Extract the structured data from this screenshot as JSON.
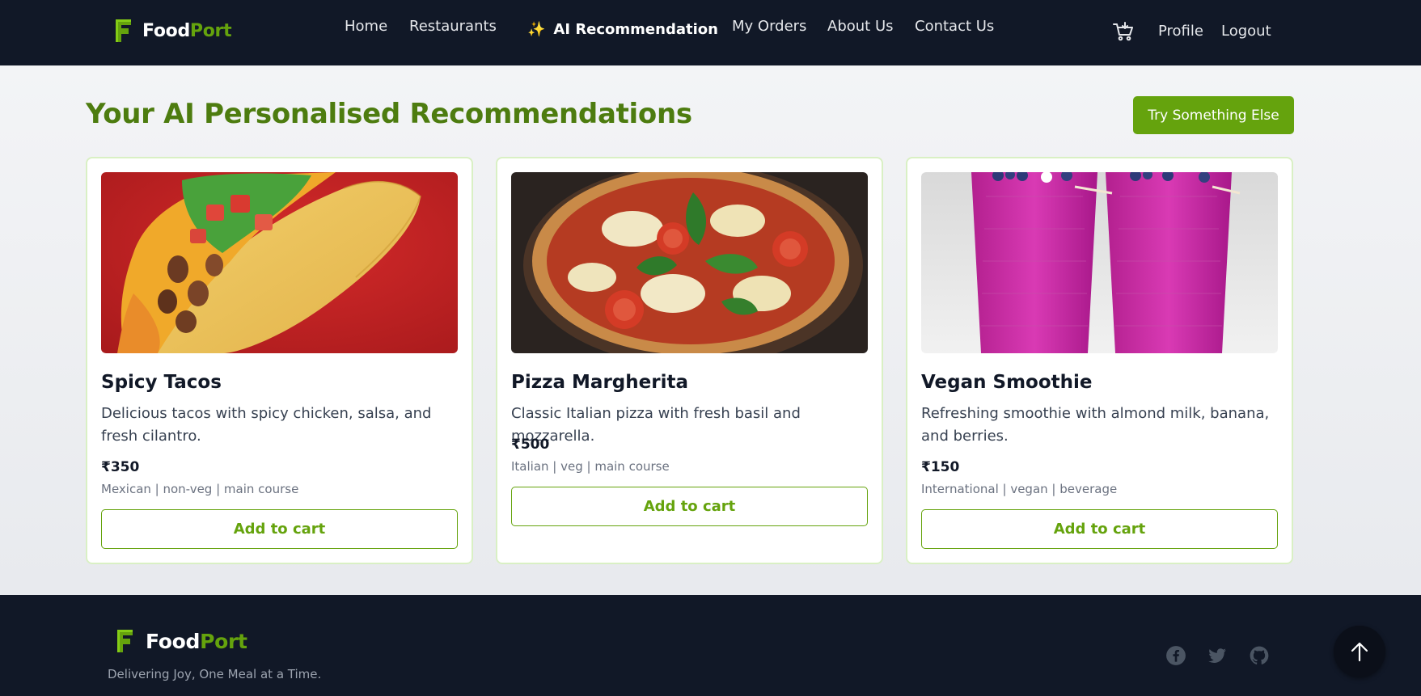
{
  "header": {
    "brand_first": "Food",
    "brand_second": "Port",
    "nav": {
      "home": "Home",
      "restaurants": "Restaurants",
      "ai": "AI Recommendation",
      "orders": "My Orders",
      "about": "About Us",
      "contact": "Contact Us"
    },
    "profile": "Profile",
    "logout": "Logout"
  },
  "main": {
    "title": "Your AI Personalised Recommendations",
    "try_button": "Try Something Else",
    "cards": [
      {
        "name": "Spicy Tacos",
        "description": "Delicious tacos with spicy chicken, salsa, and fresh cilantro.",
        "price": "₹350",
        "meta": "Mexican | non-veg | main course",
        "button": "Add to cart"
      },
      {
        "name": "Pizza Margherita",
        "description": "Classic Italian pizza with fresh basil and mozzarella.",
        "price": "₹500",
        "meta": "Italian | veg | main course",
        "button": "Add to cart"
      },
      {
        "name": "Vegan Smoothie",
        "description": "Refreshing smoothie with almond milk, banana, and berries.",
        "price": "₹150",
        "meta": "International | vegan | beverage",
        "button": "Add to cart"
      }
    ]
  },
  "footer": {
    "brand_first": "Food",
    "brand_second": "Port",
    "tagline": "Delivering Joy, One Meal at a Time.",
    "social_icons": [
      "facebook-icon",
      "twitter-icon",
      "github-icon"
    ]
  },
  "colors": {
    "nav_bg": "#111827",
    "accent_green": "#65a30d",
    "title_green": "#4d7c0f",
    "card_border": "#d9f0c4"
  },
  "icons": [
    "foodport-logo-icon",
    "sparkles-icon",
    "cart-icon",
    "arrow-up-icon"
  ]
}
